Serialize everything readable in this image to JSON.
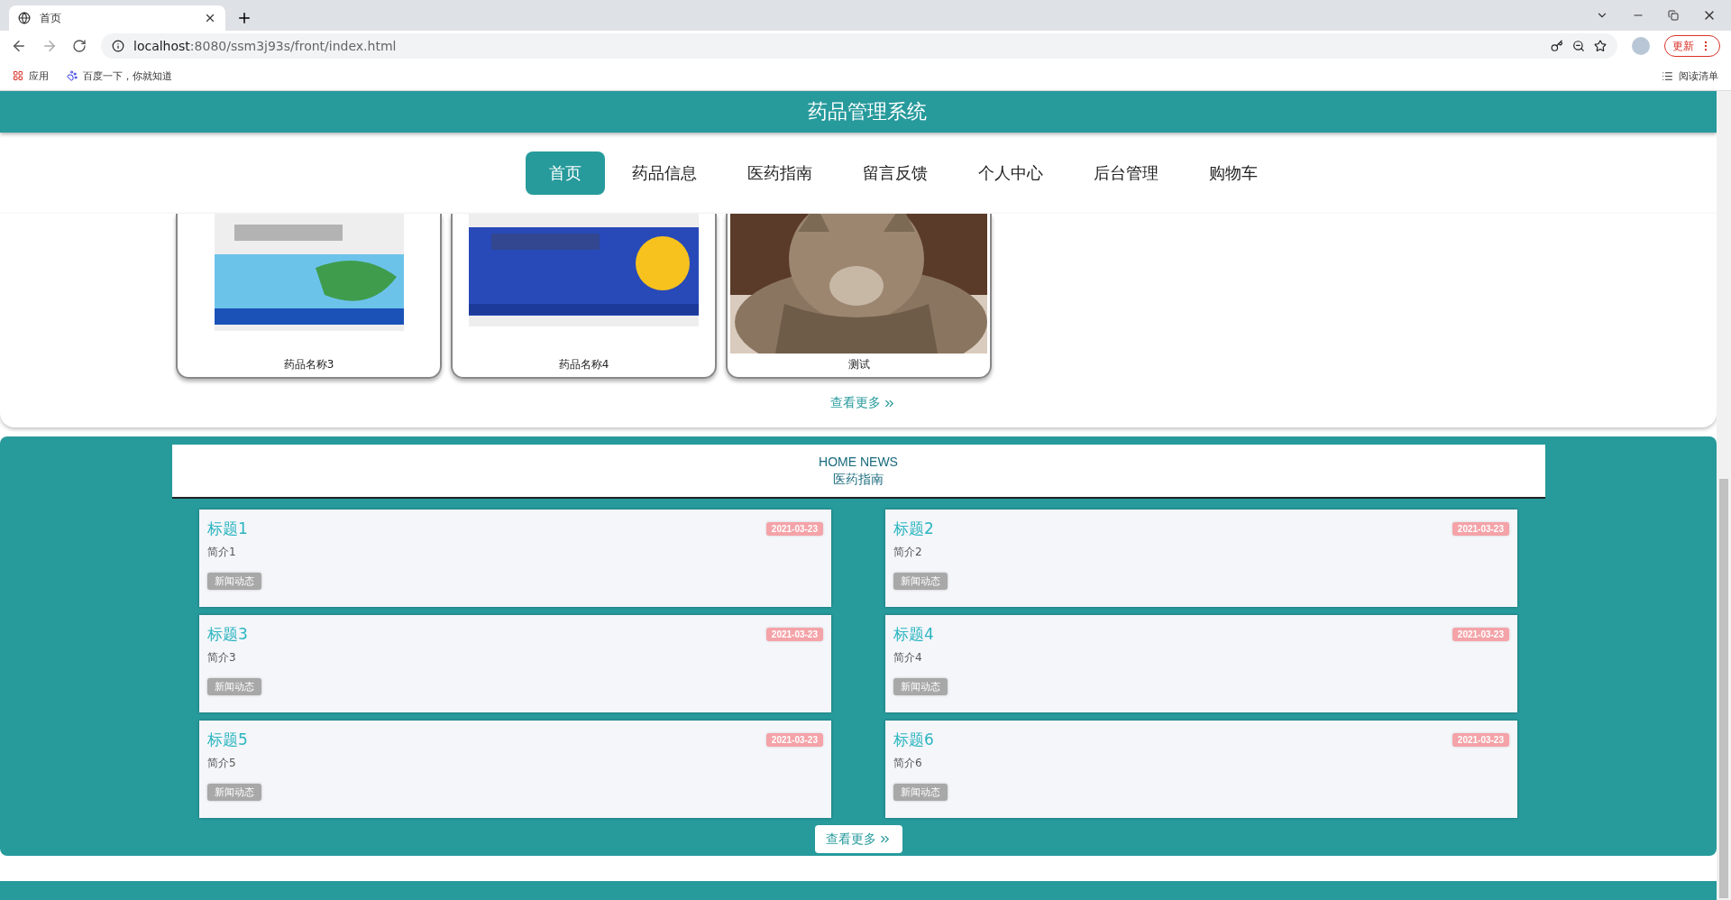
{
  "browser": {
    "tab": {
      "title": "首页",
      "selected": true
    },
    "url": {
      "host": "localhost",
      "rest": ":8080/ssm3j93s/front/index.html"
    },
    "bookmarks": [
      "应用",
      "百度一下，你就知道"
    ],
    "update_button": "更新",
    "reading_list": "阅读清单"
  },
  "header": {
    "title": "药品管理系统"
  },
  "nav": [
    {
      "label": "首页",
      "selected": true
    },
    {
      "label": "药品信息",
      "selected": false
    },
    {
      "label": "医药指南",
      "selected": false
    },
    {
      "label": "留言反馈",
      "selected": false
    },
    {
      "label": "个人中心",
      "selected": false
    },
    {
      "label": "后台管理",
      "selected": false
    },
    {
      "label": "购物车",
      "selected": false
    }
  ],
  "products": {
    "items": [
      {
        "name": "药品名称3"
      },
      {
        "name": "药品名称4"
      },
      {
        "name": "测试"
      }
    ],
    "more": "查看更多"
  },
  "news": {
    "subtitle": "HOME NEWS",
    "title": "医药指南",
    "items": [
      {
        "title": "标题1",
        "summary": "简介1",
        "date": "2021-03-23",
        "tag": "新闻动态"
      },
      {
        "title": "标题2",
        "summary": "简介2",
        "date": "2021-03-23",
        "tag": "新闻动态"
      },
      {
        "title": "标题3",
        "summary": "简介3",
        "date": "2021-03-23",
        "tag": "新闻动态"
      },
      {
        "title": "标题4",
        "summary": "简介4",
        "date": "2021-03-23",
        "tag": "新闻动态"
      },
      {
        "title": "标题5",
        "summary": "简介5",
        "date": "2021-03-23",
        "tag": "新闻动态"
      },
      {
        "title": "标题6",
        "summary": "简介6",
        "date": "2021-03-23",
        "tag": "新闻动态"
      }
    ],
    "more": "查看更多"
  }
}
